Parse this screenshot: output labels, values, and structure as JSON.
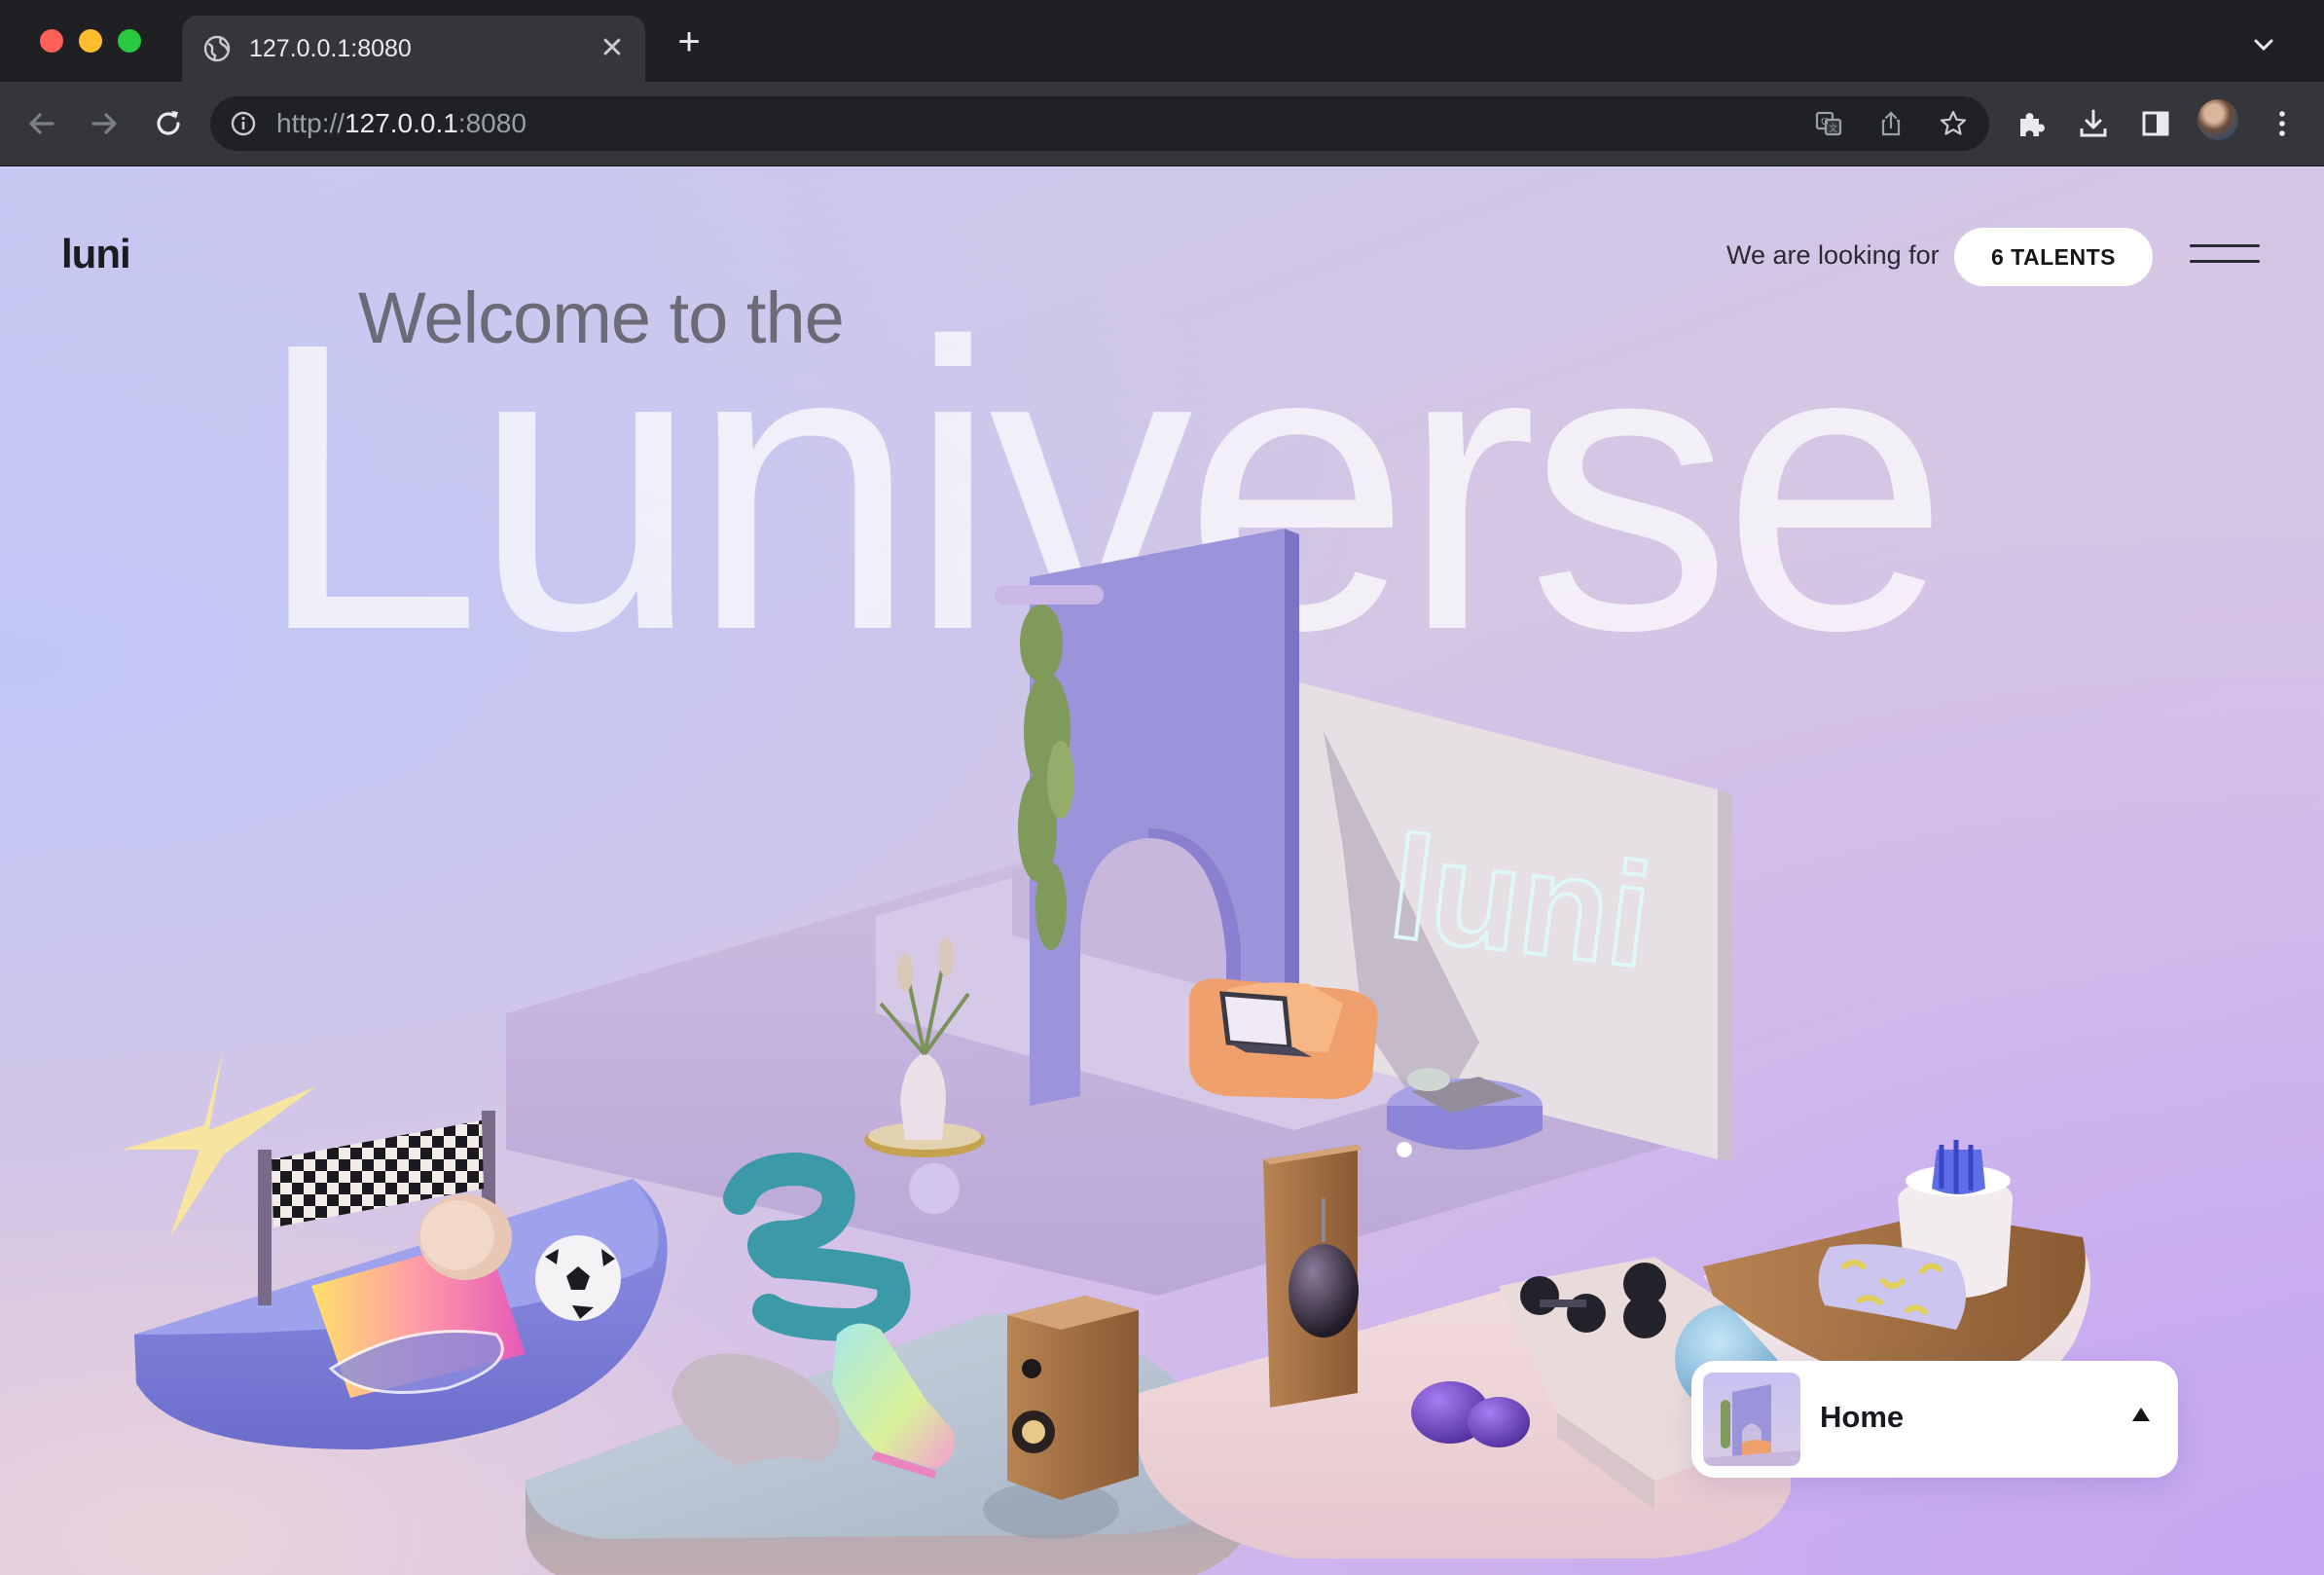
{
  "browser": {
    "tab_title": "127.0.0.1:8080",
    "url_scheme": "http://",
    "url_host": "127.0.0.1",
    "url_port": ":8080",
    "icons": [
      "globe-icon",
      "close-icon",
      "plus-icon",
      "chevron-down-icon",
      "back-icon",
      "forward-icon",
      "reload-icon",
      "info-icon",
      "translate-icon",
      "share-icon",
      "star-icon",
      "extensions-icon",
      "download-icon",
      "side-panel-icon",
      "avatar",
      "more-icon"
    ]
  },
  "header": {
    "logo": "luni",
    "looking_for": "We are looking for",
    "talents_button": "6 TALENTS"
  },
  "hero": {
    "welcome": "Welcome to the",
    "title": "Luniverse",
    "sign_text": "luni"
  },
  "page_selector": {
    "label": "Home"
  },
  "colors": {
    "accent": "#8f86d9",
    "background_start": "#c0c7f7",
    "background_end": "#cdb2ee"
  }
}
